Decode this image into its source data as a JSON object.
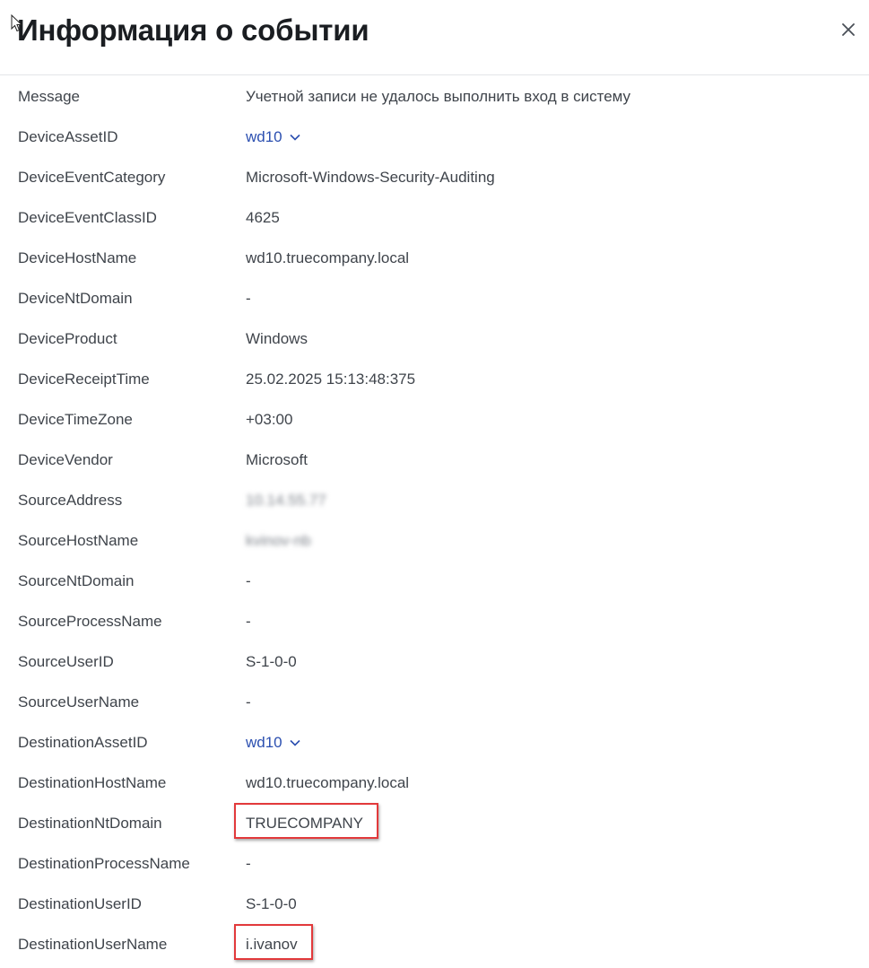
{
  "header": {
    "title": "Информация о событии",
    "close_icon": "close-icon"
  },
  "fields": [
    {
      "key": "Message",
      "value": "Учетной записи не удалось выполнить вход в систему"
    },
    {
      "key": "DeviceAssetID",
      "value": "wd10",
      "link": true
    },
    {
      "key": "DeviceEventCategory",
      "value": "Microsoft-Windows-Security-Auditing"
    },
    {
      "key": "DeviceEventClassID",
      "value": "4625"
    },
    {
      "key": "DeviceHostName",
      "value": "wd10.truecompany.local"
    },
    {
      "key": "DeviceNtDomain",
      "value": "-"
    },
    {
      "key": "DeviceProduct",
      "value": "Windows"
    },
    {
      "key": "DeviceReceiptTime",
      "value": "25.02.2025 15:13:48:375"
    },
    {
      "key": "DeviceTimeZone",
      "value": "+03:00"
    },
    {
      "key": "DeviceVendor",
      "value": "Microsoft"
    },
    {
      "key": "SourceAddress",
      "value": "10.14.55.77",
      "blurred": true
    },
    {
      "key": "SourceHostName",
      "value": "kvinov-nb",
      "blurred": true
    },
    {
      "key": "SourceNtDomain",
      "value": "-"
    },
    {
      "key": "SourceProcessName",
      "value": "-"
    },
    {
      "key": "SourceUserID",
      "value": "S-1-0-0"
    },
    {
      "key": "SourceUserName",
      "value": "-"
    },
    {
      "key": "DestinationAssetID",
      "value": "wd10",
      "link": true
    },
    {
      "key": "DestinationHostName",
      "value": "wd10.truecompany.local"
    },
    {
      "key": "DestinationNtDomain",
      "value": "TRUECOMPANY",
      "highlighted": true
    },
    {
      "key": "DestinationProcessName",
      "value": "-"
    },
    {
      "key": "DestinationUserID",
      "value": "S-1-0-0"
    },
    {
      "key": "DestinationUserName",
      "value": "i.ivanov",
      "highlighted": true
    }
  ],
  "colors": {
    "link": "#2b4fb0",
    "highlight_border": "#e2393b",
    "text": "#3f444b",
    "title": "#1a1d21"
  }
}
